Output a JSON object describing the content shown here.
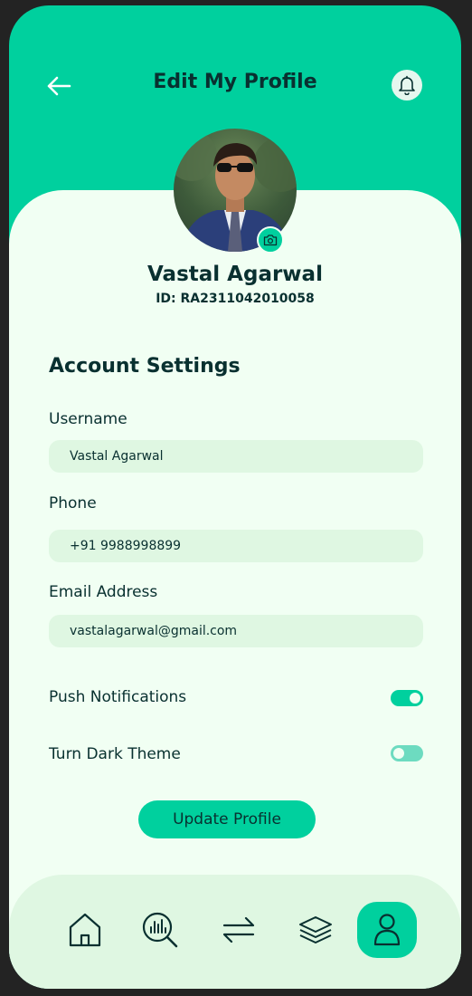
{
  "header": {
    "title": "Edit My Profile",
    "back_icon": "arrow-left-icon",
    "notification_icon": "bell-icon"
  },
  "profile": {
    "name": "Vastal Agarwal",
    "id": "ID: RA2311042010058",
    "camera_icon": "camera-icon"
  },
  "settings": {
    "title": "Account Settings",
    "fields": [
      {
        "label": "Username",
        "value": "Vastal Agarwal"
      },
      {
        "label": "Phone",
        "value": "+91 9988998899"
      },
      {
        "label": "Email Address",
        "value": "vastalagarwal@gmail.com"
      }
    ],
    "toggles": [
      {
        "label": "Push Notifications",
        "on": true
      },
      {
        "label": "Turn Dark Theme",
        "on": false
      }
    ],
    "update_label": "Update Profile"
  },
  "nav": {
    "items": [
      {
        "icon": "home-icon",
        "active": false
      },
      {
        "icon": "analysis-icon",
        "active": false
      },
      {
        "icon": "transactions-icon",
        "active": false
      },
      {
        "icon": "layers-icon",
        "active": false
      },
      {
        "icon": "profile-icon",
        "active": true
      }
    ]
  },
  "colors": {
    "primary": "#00d09e",
    "background": "#f1fff3",
    "field": "#dff7e2",
    "text": "#093030"
  }
}
